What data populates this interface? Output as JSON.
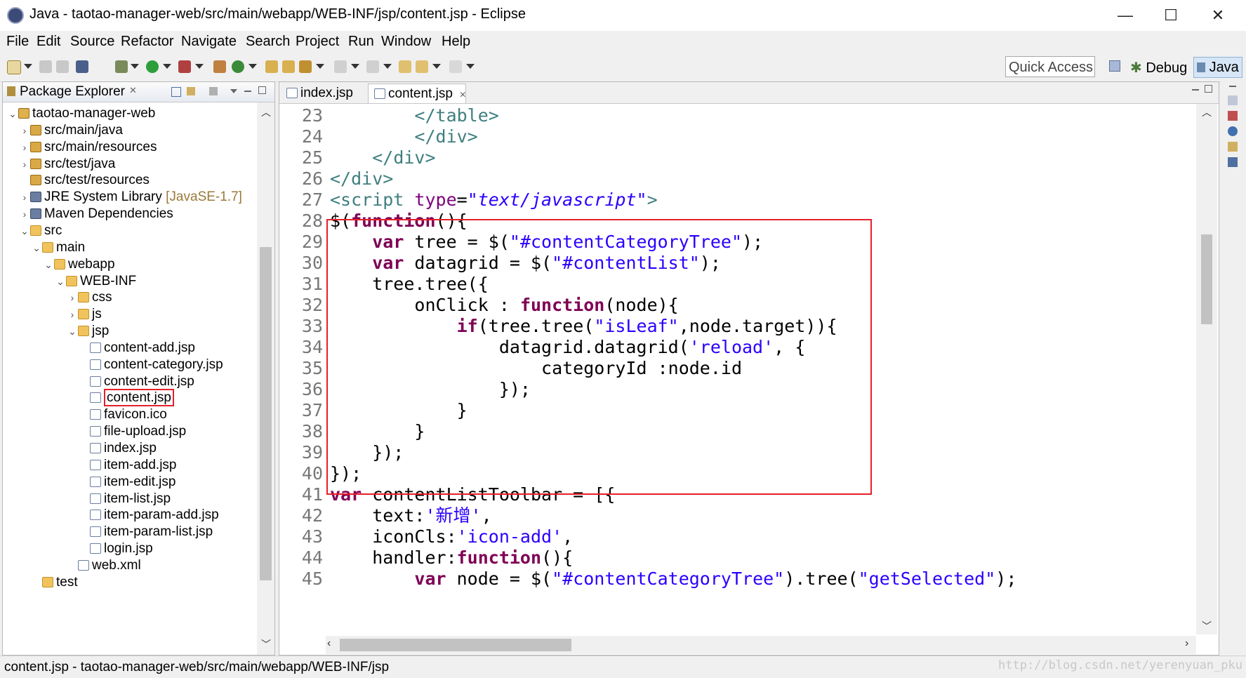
{
  "window": {
    "title": "Java - taotao-manager-web/src/main/webapp/WEB-INF/jsp/content.jsp - Eclipse",
    "controls": [
      "—",
      "☐",
      "✕"
    ]
  },
  "menu": [
    "File",
    "Edit",
    "Source",
    "Refactor",
    "Navigate",
    "Search",
    "Project",
    "Run",
    "Window",
    "Help"
  ],
  "toolbar": {
    "quick_access": "Quick Access",
    "perspectives": [
      "Debug",
      "Java"
    ]
  },
  "explorer": {
    "title": "Package Explorer",
    "close": "✕",
    "tree": [
      {
        "label": "taotao-manager-web",
        "depth": 0,
        "twisty": "⌄",
        "icon": "project-icon"
      },
      {
        "label": "src/main/java",
        "depth": 1,
        "twisty": "›",
        "icon": "package-folder-icon"
      },
      {
        "label": "src/main/resources",
        "depth": 1,
        "twisty": "›",
        "icon": "package-folder-icon"
      },
      {
        "label": "src/test/java",
        "depth": 1,
        "twisty": "›",
        "icon": "package-folder-icon"
      },
      {
        "label": "src/test/resources",
        "depth": 1,
        "twisty": "",
        "icon": "package-folder-icon"
      },
      {
        "label": "JRE System Library",
        "suffix": "[JavaSE-1.7]",
        "depth": 1,
        "twisty": "›",
        "icon": "library-icon"
      },
      {
        "label": "Maven Dependencies",
        "depth": 1,
        "twisty": "›",
        "icon": "library-icon"
      },
      {
        "label": "src",
        "depth": 1,
        "twisty": "⌄",
        "icon": "folder-icon"
      },
      {
        "label": "main",
        "depth": 2,
        "twisty": "⌄",
        "icon": "folder-icon"
      },
      {
        "label": "webapp",
        "depth": 3,
        "twisty": "⌄",
        "icon": "folder-icon"
      },
      {
        "label": "WEB-INF",
        "depth": 4,
        "twisty": "⌄",
        "icon": "folder-icon"
      },
      {
        "label": "css",
        "depth": 5,
        "twisty": "›",
        "icon": "folder-icon"
      },
      {
        "label": "js",
        "depth": 5,
        "twisty": "›",
        "icon": "folder-icon"
      },
      {
        "label": "jsp",
        "depth": 5,
        "twisty": "⌄",
        "icon": "folder-icon"
      },
      {
        "label": "content-add.jsp",
        "depth": 6,
        "twisty": "",
        "icon": "jsp-file-icon"
      },
      {
        "label": "content-category.jsp",
        "depth": 6,
        "twisty": "",
        "icon": "jsp-file-icon"
      },
      {
        "label": "content-edit.jsp",
        "depth": 6,
        "twisty": "",
        "icon": "jsp-file-icon"
      },
      {
        "label": "content.jsp",
        "depth": 6,
        "twisty": "",
        "icon": "jsp-file-icon",
        "selected": true
      },
      {
        "label": "favicon.ico",
        "depth": 6,
        "twisty": "",
        "icon": "file-icon"
      },
      {
        "label": "file-upload.jsp",
        "depth": 6,
        "twisty": "",
        "icon": "jsp-file-icon"
      },
      {
        "label": "index.jsp",
        "depth": 6,
        "twisty": "",
        "icon": "jsp-file-icon"
      },
      {
        "label": "item-add.jsp",
        "depth": 6,
        "twisty": "",
        "icon": "jsp-file-icon"
      },
      {
        "label": "item-edit.jsp",
        "depth": 6,
        "twisty": "",
        "icon": "jsp-file-icon"
      },
      {
        "label": "item-list.jsp",
        "depth": 6,
        "twisty": "",
        "icon": "jsp-file-icon"
      },
      {
        "label": "item-param-add.jsp",
        "depth": 6,
        "twisty": "",
        "icon": "jsp-file-icon"
      },
      {
        "label": "item-param-list.jsp",
        "depth": 6,
        "twisty": "",
        "icon": "jsp-file-icon"
      },
      {
        "label": "login.jsp",
        "depth": 6,
        "twisty": "",
        "icon": "jsp-file-icon"
      },
      {
        "label": "web.xml",
        "depth": 5,
        "twisty": "",
        "icon": "xml-file-icon"
      },
      {
        "label": "test",
        "depth": 2,
        "twisty": "",
        "icon": "folder-icon"
      }
    ]
  },
  "editor": {
    "tabs": [
      {
        "label": "index.jsp",
        "active": false
      },
      {
        "label": "content.jsp",
        "active": true,
        "close": "✕"
      }
    ],
    "lines": [
      {
        "n": "23",
        "segs": [
          [
            "        ",
            ""
          ],
          [
            "</table>",
            "tag"
          ]
        ]
      },
      {
        "n": "24",
        "segs": [
          [
            "        ",
            ""
          ],
          [
            "</div>",
            "tag"
          ]
        ]
      },
      {
        "n": "25",
        "segs": [
          [
            "    ",
            ""
          ],
          [
            "</div>",
            "tag"
          ]
        ]
      },
      {
        "n": "26",
        "segs": [
          [
            "</div>",
            "tag"
          ]
        ]
      },
      {
        "n": "27",
        "segs": [
          [
            "<script ",
            "tag"
          ],
          [
            "type",
            "attr"
          ],
          [
            "=",
            ""
          ],
          [
            "\"text/javascript\"",
            "aval"
          ],
          [
            ">",
            "tag"
          ]
        ]
      },
      {
        "n": "28",
        "segs": [
          [
            "$(",
            ""
          ],
          [
            "function",
            "kw"
          ],
          [
            "(){",
            ""
          ]
        ]
      },
      {
        "n": "29",
        "segs": [
          [
            "    ",
            ""
          ],
          [
            "var",
            "kw"
          ],
          [
            " tree = $(",
            ""
          ],
          [
            "\"#contentCategoryTree\"",
            "str"
          ],
          [
            ");",
            ""
          ]
        ]
      },
      {
        "n": "30",
        "segs": [
          [
            "    ",
            ""
          ],
          [
            "var",
            "kw"
          ],
          [
            " datagrid = $(",
            ""
          ],
          [
            "\"#contentList\"",
            "str"
          ],
          [
            ");",
            ""
          ]
        ]
      },
      {
        "n": "31",
        "segs": [
          [
            "    tree.tree({",
            ""
          ]
        ]
      },
      {
        "n": "32",
        "segs": [
          [
            "        onClick : ",
            ""
          ],
          [
            "function",
            "kw"
          ],
          [
            "(node){",
            ""
          ]
        ]
      },
      {
        "n": "33",
        "segs": [
          [
            "            ",
            ""
          ],
          [
            "if",
            "kw"
          ],
          [
            "(tree.tree(",
            ""
          ],
          [
            "\"isLeaf\"",
            "str"
          ],
          [
            ",node.target)){",
            ""
          ]
        ]
      },
      {
        "n": "34",
        "segs": [
          [
            "                datagrid.datagrid(",
            ""
          ],
          [
            "'reload'",
            "str"
          ],
          [
            ", {",
            ""
          ]
        ]
      },
      {
        "n": "35",
        "segs": [
          [
            "                    categoryId :node.id",
            ""
          ]
        ]
      },
      {
        "n": "36",
        "segs": [
          [
            "                });",
            ""
          ]
        ]
      },
      {
        "n": "37",
        "segs": [
          [
            "            }",
            ""
          ]
        ]
      },
      {
        "n": "38",
        "segs": [
          [
            "        }",
            ""
          ]
        ]
      },
      {
        "n": "39",
        "segs": [
          [
            "    });",
            ""
          ]
        ]
      },
      {
        "n": "40",
        "segs": [
          [
            "});",
            ""
          ]
        ]
      },
      {
        "n": "41",
        "segs": [
          [
            "var",
            "kw"
          ],
          [
            " contentListToolbar = [{",
            ""
          ]
        ]
      },
      {
        "n": "42",
        "segs": [
          [
            "    text:",
            ""
          ],
          [
            "'新增'",
            "str"
          ],
          [
            ",",
            ""
          ]
        ]
      },
      {
        "n": "43",
        "segs": [
          [
            "    iconCls:",
            ""
          ],
          [
            "'icon-add'",
            "str"
          ],
          [
            ",",
            ""
          ]
        ]
      },
      {
        "n": "44",
        "segs": [
          [
            "    handler:",
            ""
          ],
          [
            "function",
            "kw"
          ],
          [
            "(){",
            ""
          ]
        ]
      },
      {
        "n": "45",
        "segs": [
          [
            "        ",
            ""
          ],
          [
            "var",
            "kw"
          ],
          [
            " node = $(",
            ""
          ],
          [
            "\"#contentCategoryTree\"",
            "str"
          ],
          [
            ").tree(",
            ""
          ],
          [
            "\"getSelected\"",
            "str"
          ],
          [
            ");",
            ""
          ]
        ]
      }
    ]
  },
  "status": {
    "path": "content.jsp - taotao-manager-web/src/main/webapp/WEB-INF/jsp"
  },
  "watermark": "http://blog.csdn.net/yerenyuan_pku",
  "colors": {
    "keyword": "#7f0055",
    "string": "#2a00ff",
    "tag": "#3f7f7f",
    "highlight_box": "#e5202a",
    "selection_box": "#e5202a"
  }
}
